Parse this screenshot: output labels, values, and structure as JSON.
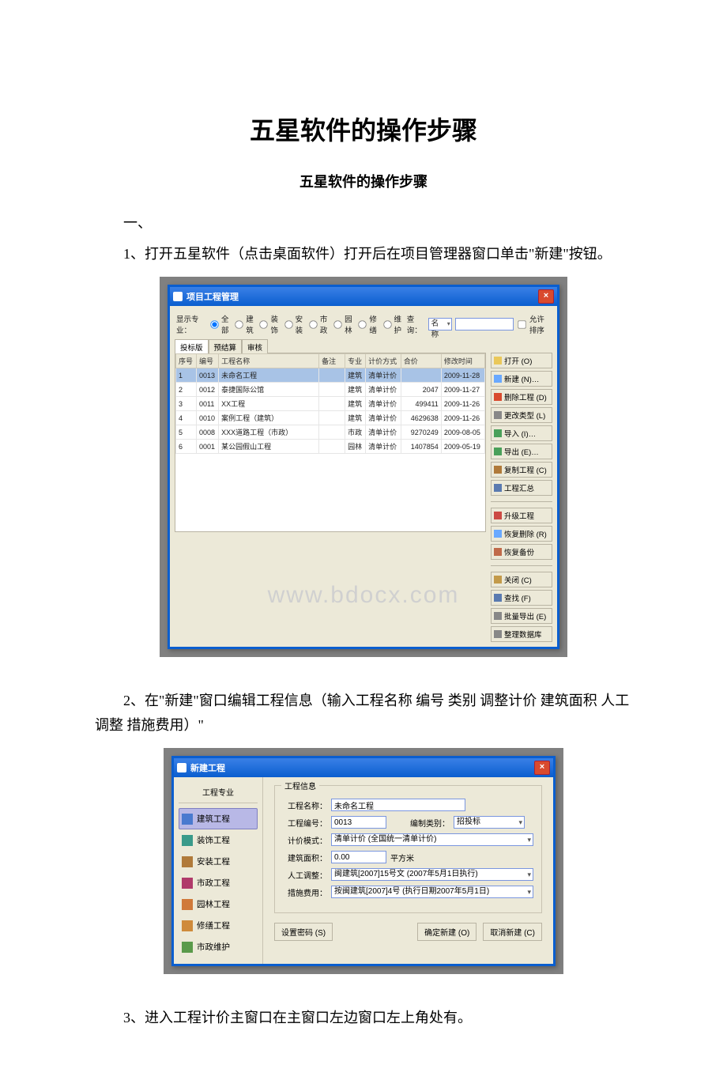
{
  "doc": {
    "title": "五星软件的操作步骤",
    "subtitle": "五星软件的操作步骤",
    "section1": "一、",
    "step1": "1、打开五星软件（点击桌面软件）打开后在项目管理器窗口单击\"新建\"按钮。",
    "step2": "2、在\"新建\"窗口编辑工程信息（输入工程名称 编号 类别 调整计价 建筑面积 人工调整 措施费用）\"",
    "step3": "3、进入工程计价主窗口在主窗口左边窗口左上角处有。"
  },
  "pm": {
    "title": "项目工程管理",
    "filterLabel": "显示专业：",
    "radios": [
      "全部",
      "建筑",
      "装饰",
      "安装",
      "市政",
      "园林",
      "修缮",
      "维护"
    ],
    "searchLabel": "查询：",
    "searchMode": "名称",
    "sortCheck": "允许排序",
    "tabs": [
      "投标版",
      "预结算",
      "审核"
    ],
    "cols": [
      "序号",
      "编号",
      "工程名称",
      "备注",
      "专业",
      "计价方式",
      "合价",
      "修改时间"
    ],
    "rows": [
      {
        "n": "1",
        "id": "0013",
        "name": "未命名工程",
        "remark": "",
        "spec": "建筑",
        "mode": "清单计价",
        "price": "",
        "date": "2009-11-28",
        "sel": true
      },
      {
        "n": "2",
        "id": "0012",
        "name": "泰捷国际公馆",
        "remark": "",
        "spec": "建筑",
        "mode": "清单计价",
        "price": "2047",
        "date": "2009-11-27"
      },
      {
        "n": "3",
        "id": "0011",
        "name": "XX工程",
        "remark": "",
        "spec": "建筑",
        "mode": "清单计价",
        "price": "499411",
        "date": "2009-11-26"
      },
      {
        "n": "4",
        "id": "0010",
        "name": "案例工程（建筑）",
        "remark": "",
        "spec": "建筑",
        "mode": "清单计价",
        "price": "4629638",
        "date": "2009-11-26"
      },
      {
        "n": "5",
        "id": "0008",
        "name": "XXX道路工程（市政）",
        "remark": "",
        "spec": "市政",
        "mode": "清单计价",
        "price": "9270249",
        "date": "2009-08-05"
      },
      {
        "n": "6",
        "id": "0001",
        "name": "某公园假山工程",
        "remark": "",
        "spec": "园林",
        "mode": "清单计价",
        "price": "1407854",
        "date": "2009-05-19"
      }
    ],
    "btns": {
      "open": "打开 (O)",
      "new": "新建 (N)…",
      "del": "删除工程 (D)",
      "mod": "更改类型 (L)",
      "imp": "导入 (I)…",
      "exp": "导出 (E)…",
      "copy": "复制工程 (C)",
      "sum": "工程汇总",
      "up": "升级工程",
      "rest": "恢复删除 (R)",
      "back": "恢复备份",
      "close": "关闭 (C)",
      "find": "查找 (F)",
      "batch": "批量导出 (E)",
      "db": "整理数据库"
    },
    "watermark": "www.bdocx.com"
  },
  "np": {
    "title": "新建工程",
    "catHeader": "工程专业",
    "cats": [
      "建筑工程",
      "装饰工程",
      "安装工程",
      "市政工程",
      "园林工程",
      "修缮工程",
      "市政维护"
    ],
    "grpLabel": "工程信息",
    "f": {
      "nameLbl": "工程名称：",
      "name": "未命名工程",
      "codeLbl": "工程编号：",
      "code": "0013",
      "typeLbl": "编制类别：",
      "type": "招投标",
      "modeLbl": "计价模式：",
      "mode": "清单计价 (全国统一清单计价)",
      "areaLbl": "建筑面积：",
      "area": "0.00",
      "areaUnit": "平方米",
      "laborLbl": "人工调整：",
      "labor": "闽建筑[2007]15号文 (2007年5月1日执行)",
      "measureLbl": "措施费用：",
      "measure": "按闽建筑[2007]4号 (执行日期2007年5月1日)"
    },
    "btns": {
      "pwd": "设置密码 (S)",
      "ok": "确定新建 (O)",
      "cancel": "取消新建 (C)"
    }
  }
}
